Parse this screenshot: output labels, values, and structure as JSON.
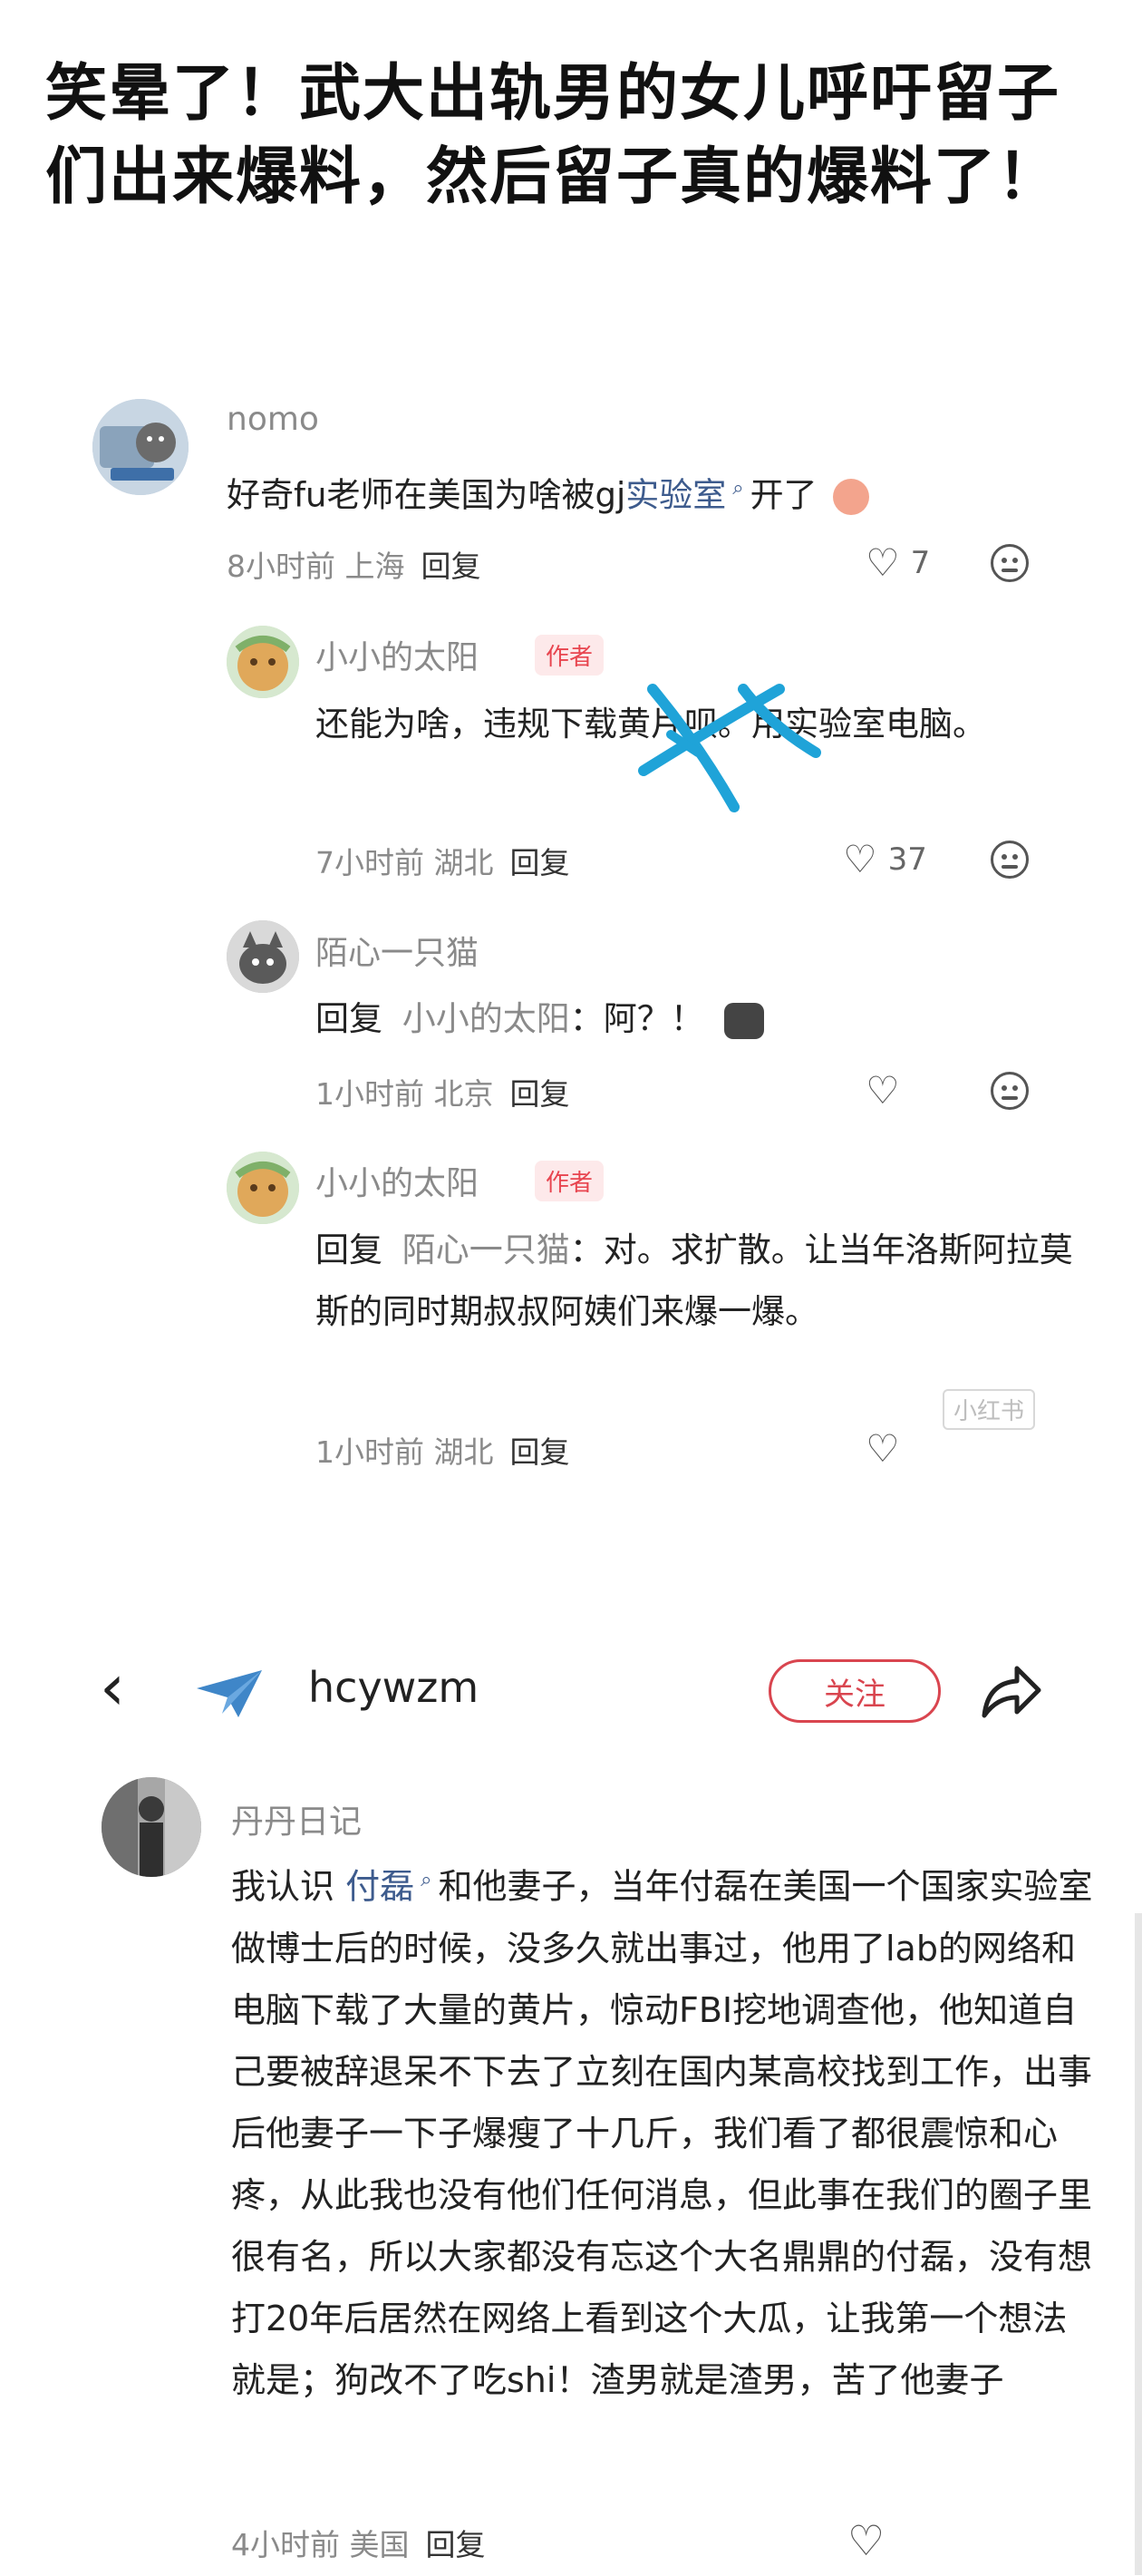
{
  "post": {
    "title": "笑晕了！武大出轨男的女儿呼吁留子们出来爆料，然后留子真的爆料了！"
  },
  "thread1": {
    "c1": {
      "username": "nomo",
      "text_before": "好奇fu老师在美国为啥被gj",
      "link": "实验室",
      "text_after": "开了",
      "time": "8小时前 上海",
      "reply": "回复",
      "likes": "7"
    },
    "c2": {
      "username": "小小的太阳",
      "badge": "作者",
      "text": "还能为啥，违规下载黄片呗。用实验室电脑。",
      "time": "7小时前 湖北",
      "reply": "回复",
      "likes": "37"
    },
    "c3": {
      "username": "陌心一只猫",
      "reply_prefix": "回复",
      "mention": "小小的太阳",
      "text": "：阿？！",
      "time": "1小时前 北京",
      "reply": "回复",
      "likes": ""
    },
    "c4": {
      "username": "小小的太阳",
      "badge": "作者",
      "reply_prefix": "回复",
      "mention": "陌心一只猫",
      "text": "：对。求扩散。让当年洛斯阿拉莫斯的同时期叔叔阿姨们来爆一爆。",
      "time": "1小时前 湖北",
      "reply": "回复"
    },
    "watermark": "小红书"
  },
  "nav": {
    "name": "hcywzm",
    "follow": "关注"
  },
  "thread2": {
    "username": "丹丹日记",
    "text_before": "我认识",
    "link": "付磊",
    "text_after": "和他妻子，当年付磊在美国一个国家实验室做博士后的时候，没多久就出事过，他用了lab的网络和电脑下载了大量的黄片，惊动FBI挖地调查他，他知道自己要被辞退呆不下去了立刻在国内某高校找到工作，出事后他妻子一下子爆瘦了十几斤，我们看了都很震惊和心疼，从此我也没有他们任何消息，但此事在我们的圈子里很有名，所以大家都没有忘这个大名鼎鼎的付磊，没有想打20年后居然在网络上看到这个大瓜，让我第一个想法就是；狗改不了吃shi！渣男就是渣男，苦了他妻子",
    "time": "4小时前 美国",
    "reply": "回复"
  },
  "colors": {
    "link": "#3d5b8d",
    "badge": "#e8454f",
    "follow": "#d9454f",
    "scribble": "#1fa3d8"
  }
}
